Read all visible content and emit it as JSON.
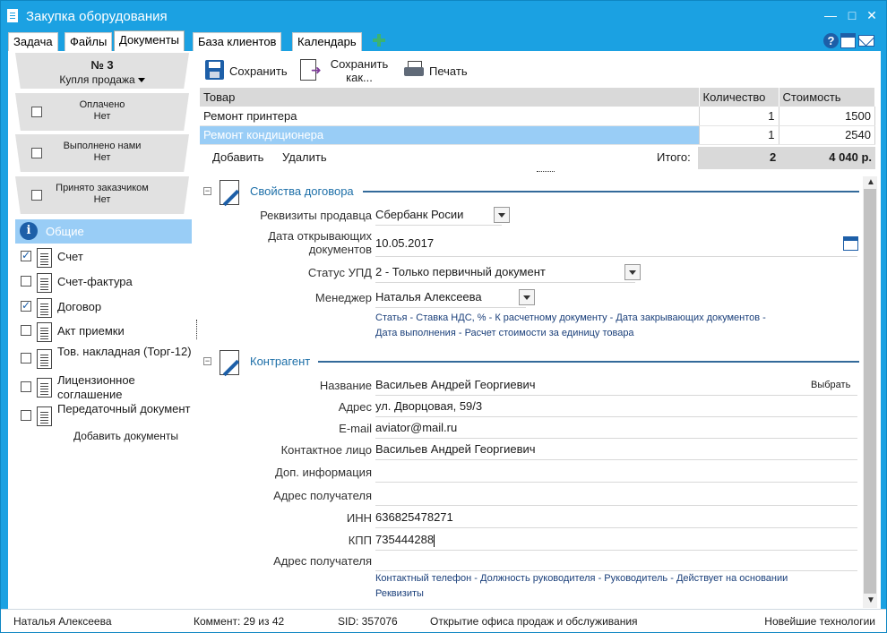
{
  "window": {
    "title": "Закупка оборудования"
  },
  "tabs": [
    {
      "label": "Задача"
    },
    {
      "label": "Файлы"
    },
    {
      "label": "Документы"
    },
    {
      "label": "База клиентов"
    },
    {
      "label": "Календарь"
    }
  ],
  "stage": {
    "number": "№ 3",
    "type": "Купля продажа"
  },
  "statuses": [
    {
      "label": "Оплачено",
      "value": "Нет"
    },
    {
      "label": "Выполнено нами",
      "value": "Нет"
    },
    {
      "label": "Принято заказчиком",
      "value": "Нет"
    }
  ],
  "doc_group": {
    "label": "Общие"
  },
  "documents": [
    {
      "label": "Счет",
      "checked": true
    },
    {
      "label": "Счет-фактура",
      "checked": false
    },
    {
      "label": "Договор",
      "checked": true
    },
    {
      "label": "Акт приемки",
      "checked": false
    },
    {
      "label": "Тов. накладная (Торг-12)",
      "checked": false
    },
    {
      "label": "Лицензионное соглашение",
      "checked": false
    },
    {
      "label": "Передаточный документ",
      "checked": false
    }
  ],
  "add_documents": "Добавить документы",
  "toolbar": {
    "save": "Сохранить",
    "save_as": "Сохранить как...",
    "print": "Печать"
  },
  "goods": {
    "headers": [
      "Товар",
      "Количество",
      "Стоимость"
    ],
    "rows": [
      {
        "name": "Ремонт принтера",
        "qty": "1",
        "cost": "1500"
      },
      {
        "name": "Ремонт кондиционера",
        "qty": "1",
        "cost": "2540"
      }
    ],
    "add": "Добавить",
    "delete": "Удалить",
    "total_label": "Итого:",
    "total_qty": "2",
    "total_cost": "4 040 р."
  },
  "contract": {
    "title": "Свойства договора",
    "fields": [
      {
        "label": "Реквизиты продавца",
        "value": "Сбербанк Росии"
      },
      {
        "label": "Дата открывающих документов",
        "value": "10.05.2017"
      },
      {
        "label": "Статус УПД",
        "value": "2 - Только первичный документ"
      },
      {
        "label": "Менеджер",
        "value": "Наталья Алексеева"
      }
    ],
    "links": [
      "Статья",
      "Ставка НДС, %",
      "К расчетному документу",
      "Дата закрывающих документов",
      "Дата выполнения",
      "Расчет стоимости за единицу товара"
    ]
  },
  "contractor": {
    "title": "Контрагент",
    "select": "Выбрать",
    "fields": [
      {
        "label": "Название",
        "value": "Васильев Андрей Георгиевич"
      },
      {
        "label": "Адрес",
        "value": "ул. Дворцовая, 59/3"
      },
      {
        "label": "E-mail",
        "value": "aviator@mail.ru"
      },
      {
        "label": "Контактное лицо",
        "value": "Васильев Андрей Георгиевич"
      },
      {
        "label": "Доп. информация",
        "value": ""
      },
      {
        "label": "Адрес получателя",
        "value": ""
      },
      {
        "label": "ИНН",
        "value": "636825478271"
      },
      {
        "label": "КПП",
        "value": "735444288"
      },
      {
        "label": "Адрес получателя",
        "value": ""
      }
    ],
    "links": [
      "Контактный телефон",
      "Должность руководителя",
      "Руководитель",
      "Действует на основании",
      "Реквизиты"
    ]
  },
  "status": {
    "user": "Наталья Алексеева",
    "comments": "Коммент: 29 из 42",
    "sid": "SID: 357076",
    "project": "Открытие офиса продаж и обслуживания",
    "company": "Новейшие технологии"
  },
  "colors": {
    "titlebar": "#1ba1e2",
    "accent": "#99cdf6",
    "link": "#1a3f7a",
    "section": "#1d6fa8"
  }
}
